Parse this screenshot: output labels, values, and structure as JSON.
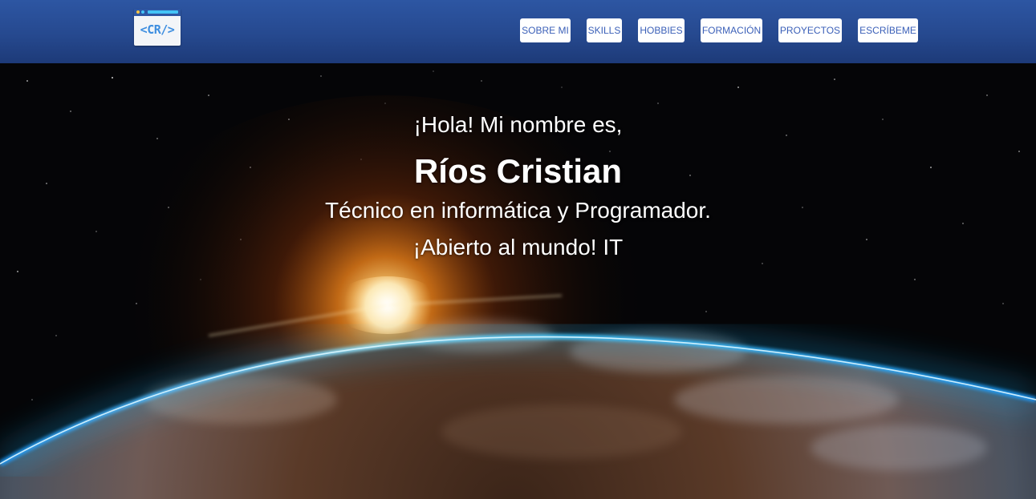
{
  "logo": {
    "text": "<CR/>"
  },
  "nav": {
    "items": [
      {
        "label": "SOBRE MI"
      },
      {
        "label": "SKILLS"
      },
      {
        "label": "HOBBIES"
      },
      {
        "label": "FORMACIÓN"
      },
      {
        "label": "PROYECTOS"
      },
      {
        "label": "ESCRÍBEME"
      }
    ]
  },
  "hero": {
    "greeting": "¡Hola! Mi nombre es,",
    "name": "Ríos Cristian",
    "title": "Técnico en informática y Programador.",
    "tagline": "¡Abierto al mundo! IT",
    "background": "earth-sunrise-from-space"
  },
  "colors": {
    "navbar": "#26498f",
    "nav_button_bg": "#ffffff",
    "nav_button_text": "#3a5fb8",
    "logo_text": "#3d8ee0",
    "hero_text": "#ffffff",
    "atmosphere": "#1fb8ff",
    "sun_glow": "#ff8a1a"
  }
}
